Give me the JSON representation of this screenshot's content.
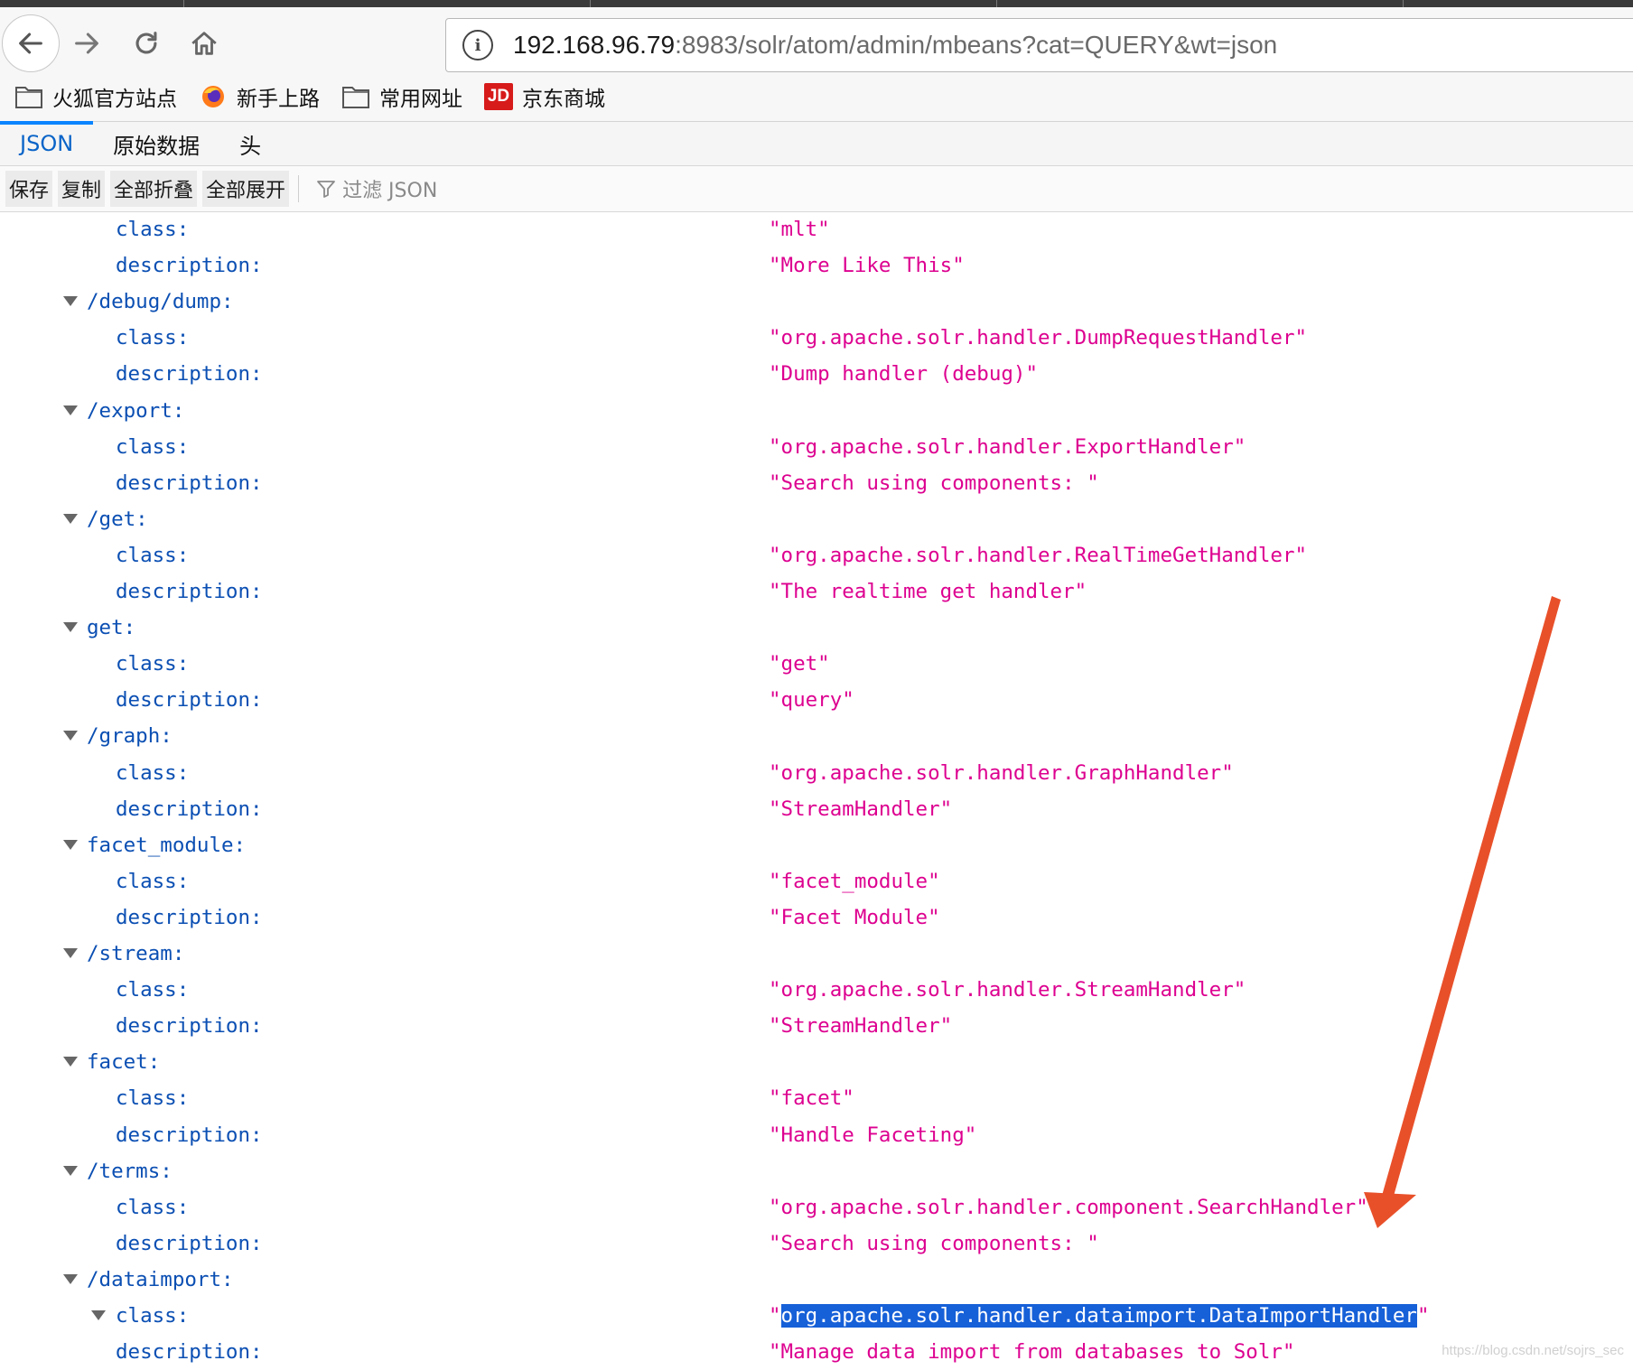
{
  "browser": {
    "url_host": "192.168.96.79",
    "url_path": ":8983/solr/atom/admin/mbeans?cat=QUERY&wt=json",
    "info_icon": "info-icon"
  },
  "bookmarks": [
    {
      "label": "火狐官方站点",
      "icon": "folder-icon"
    },
    {
      "label": "新手上路",
      "icon": "firefox-icon"
    },
    {
      "label": "常用网址",
      "icon": "folder-icon"
    },
    {
      "label": "京东商城",
      "icon": "jd-logo-icon",
      "logo_text": "JD"
    }
  ],
  "viewer_tabs": [
    {
      "label": "JSON",
      "active": true
    },
    {
      "label": "原始数据",
      "active": false
    },
    {
      "label": "头",
      "active": false
    }
  ],
  "actions": {
    "save": "保存",
    "copy": "复制",
    "collapse_all": "全部折叠",
    "expand_all": "全部展开",
    "filter_placeholder": "过滤 JSON"
  },
  "tree": [
    {
      "kind": "prop",
      "key": "class:",
      "value": "\"mlt\""
    },
    {
      "kind": "prop",
      "key": "description:",
      "value": "\"More Like This\""
    },
    {
      "kind": "group",
      "key": "/debug/dump:"
    },
    {
      "kind": "prop",
      "key": "class:",
      "value": "\"org.apache.solr.handler.DumpRequestHandler\""
    },
    {
      "kind": "prop",
      "key": "description:",
      "value": "\"Dump handler (debug)\""
    },
    {
      "kind": "group",
      "key": "/export:"
    },
    {
      "kind": "prop",
      "key": "class:",
      "value": "\"org.apache.solr.handler.ExportHandler\""
    },
    {
      "kind": "prop",
      "key": "description:",
      "value": "\"Search using components: \""
    },
    {
      "kind": "group",
      "key": "/get:"
    },
    {
      "kind": "prop",
      "key": "class:",
      "value": "\"org.apache.solr.handler.RealTimeGetHandler\""
    },
    {
      "kind": "prop",
      "key": "description:",
      "value": "\"The realtime get handler\""
    },
    {
      "kind": "group",
      "key": "get:"
    },
    {
      "kind": "prop",
      "key": "class:",
      "value": "\"get\""
    },
    {
      "kind": "prop",
      "key": "description:",
      "value": "\"query\""
    },
    {
      "kind": "group",
      "key": "/graph:"
    },
    {
      "kind": "prop",
      "key": "class:",
      "value": "\"org.apache.solr.handler.GraphHandler\""
    },
    {
      "kind": "prop",
      "key": "description:",
      "value": "\"StreamHandler\""
    },
    {
      "kind": "group",
      "key": "facet_module:"
    },
    {
      "kind": "prop",
      "key": "class:",
      "value": "\"facet_module\""
    },
    {
      "kind": "prop",
      "key": "description:",
      "value": "\"Facet Module\""
    },
    {
      "kind": "group",
      "key": "/stream:"
    },
    {
      "kind": "prop",
      "key": "class:",
      "value": "\"org.apache.solr.handler.StreamHandler\""
    },
    {
      "kind": "prop",
      "key": "description:",
      "value": "\"StreamHandler\""
    },
    {
      "kind": "group",
      "key": "facet:"
    },
    {
      "kind": "prop",
      "key": "class:",
      "value": "\"facet\""
    },
    {
      "kind": "prop",
      "key": "description:",
      "value": "\"Handle Faceting\""
    },
    {
      "kind": "group",
      "key": "/terms:"
    },
    {
      "kind": "prop",
      "key": "class:",
      "value": "\"org.apache.solr.handler.component.SearchHandler\""
    },
    {
      "kind": "prop",
      "key": "description:",
      "value": "\"Search using components: \""
    },
    {
      "kind": "group",
      "key": "/dataimport:"
    },
    {
      "kind": "prop",
      "key": "class:",
      "value": "\"org.apache.solr.handler.dataimport.DataImportHandler\"",
      "expandable": true,
      "selected_text": "org.apache.solr.handler.dataimport.DataImportHandler"
    },
    {
      "kind": "prop",
      "key": "description:",
      "value": "\"Manage data import from databases to Solr\""
    }
  ],
  "annotation": {
    "color": "#e8502a",
    "shape": "arrow",
    "points_to": "/dataimport class value"
  },
  "watermark": "https://blog.csdn.net/sojrs_sec",
  "colors": {
    "key": "#0b4fb3",
    "value": "#dd0090",
    "selection": "#1660d8",
    "active_tab": "#0a64c8"
  }
}
